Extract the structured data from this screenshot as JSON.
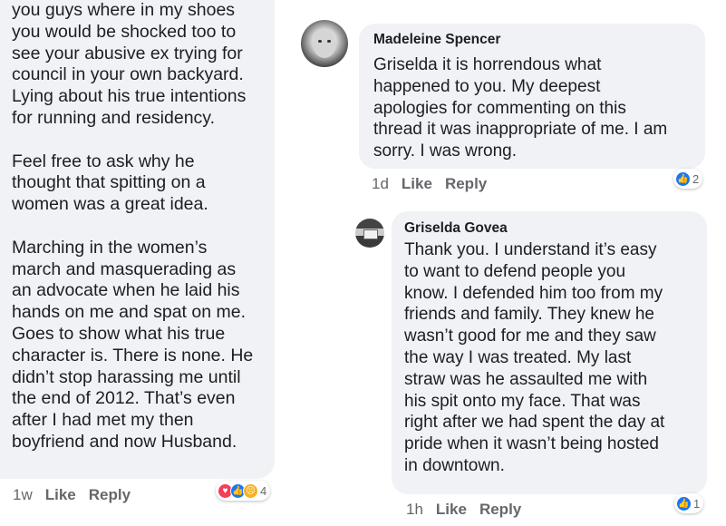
{
  "left_comment": {
    "text": "you guys where in my shoes\nyou would be shocked too to\nsee your abusive ex trying for\ncouncil in your own backyard.\nLying about his true intentions\nfor running and residency.\n\nFeel free to ask why he\nthought that spitting on a\nwomen was a great idea.\n\nMarching in the women’s\nmarch and masquerading as\nan advocate when he laid his\nhands on me and spat on me.\nGoes to show what his true\ncharacter is. There is none. He\ndidn’t stop harassing me until\nthe end of 2012. That’s even\nafter I had met my then\nboyfriend and now Husband.",
    "time": "1w",
    "like_label": "Like",
    "reply_label": "Reply",
    "reaction_count": "4",
    "reaction_icons": [
      "love-icon",
      "like-icon",
      "sad-icon"
    ]
  },
  "comment_madeleine": {
    "name": "Madeleine Spencer",
    "text": "Griselda it is horrendous what\nhappened to you. My deepest\napologies for commenting on this\nthread it was inappropriate of me. I am\nsorry. I was wrong.",
    "time": "1d",
    "like_label": "Like",
    "reply_label": "Reply",
    "reaction_count": "2",
    "reaction_icons": [
      "like-icon"
    ]
  },
  "comment_griselda": {
    "name": "Griselda Govea",
    "text": "Thank you. I understand it’s easy\nto want to defend people you\nknow. I defended him too from my\nfriends and family. They knew he\nwasn’t good for me and they saw\nthe way I was treated. My last\nstraw was he assaulted me with\nhis spit onto my face. That was\nright after we had spent the day at\npride when it wasn’t being hosted\nin downtown.",
    "time": "1h",
    "like_label": "Like",
    "reply_label": "Reply",
    "reaction_count": "1",
    "reaction_icons": [
      "like-icon"
    ]
  },
  "colors": {
    "bubble": "#f0f2f5",
    "like_blue": "#1877f2",
    "love_red": "#f33e58",
    "sad_yellow": "#f7b125",
    "meta_gray": "#65676b"
  }
}
